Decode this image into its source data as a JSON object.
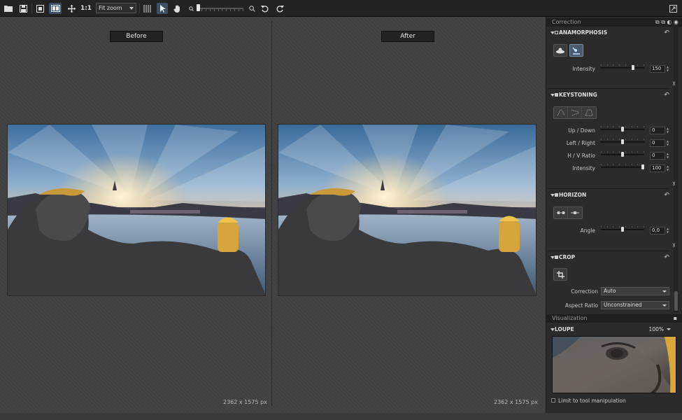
{
  "toolbar": {
    "zoom_ratio_label": "1:1",
    "zoom_select_value": "Fit zoom",
    "zoom_percent": 0.0
  },
  "viewer": {
    "before_label": "Before",
    "after_label": "After",
    "before_size": "2362 x 1575 px",
    "after_size": "2362 x 1575 px"
  },
  "panel": {
    "correction_header": "Correction",
    "visualization_header": "Visualization",
    "anamorphosis": {
      "title": "ANAMORPHOSIS",
      "intensity_label": "Intensity",
      "intensity_value": "150",
      "intensity_fraction": 0.75
    },
    "keystoning": {
      "title": "KEYSTONING",
      "rows": [
        {
          "label": "Up / Down",
          "value": "0",
          "fraction": 0.5
        },
        {
          "label": "Left / Right",
          "value": "0",
          "fraction": 0.5
        },
        {
          "label": "H / V Ratio",
          "value": "0",
          "fraction": 0.5
        },
        {
          "label": "Intensity",
          "value": "100",
          "fraction": 1.0
        }
      ]
    },
    "horizon": {
      "title": "HORIZON",
      "angle_label": "Angle",
      "angle_value": "0,0",
      "angle_fraction": 0.5
    },
    "crop": {
      "title": "CROP",
      "correction_label": "Correction",
      "correction_value": "Auto",
      "aspect_label": "Aspect Ratio",
      "aspect_value": "Unconstrained"
    },
    "loupe": {
      "title": "LOUPE",
      "zoom": "100%",
      "limit_label": "Limit to tool manipulation"
    }
  },
  "colors": {
    "toolbar_bg": "#232323",
    "viewer_bg": "#414141",
    "panel_bg": "#2b2b2b",
    "accent_selected": "#4a5b6f"
  }
}
